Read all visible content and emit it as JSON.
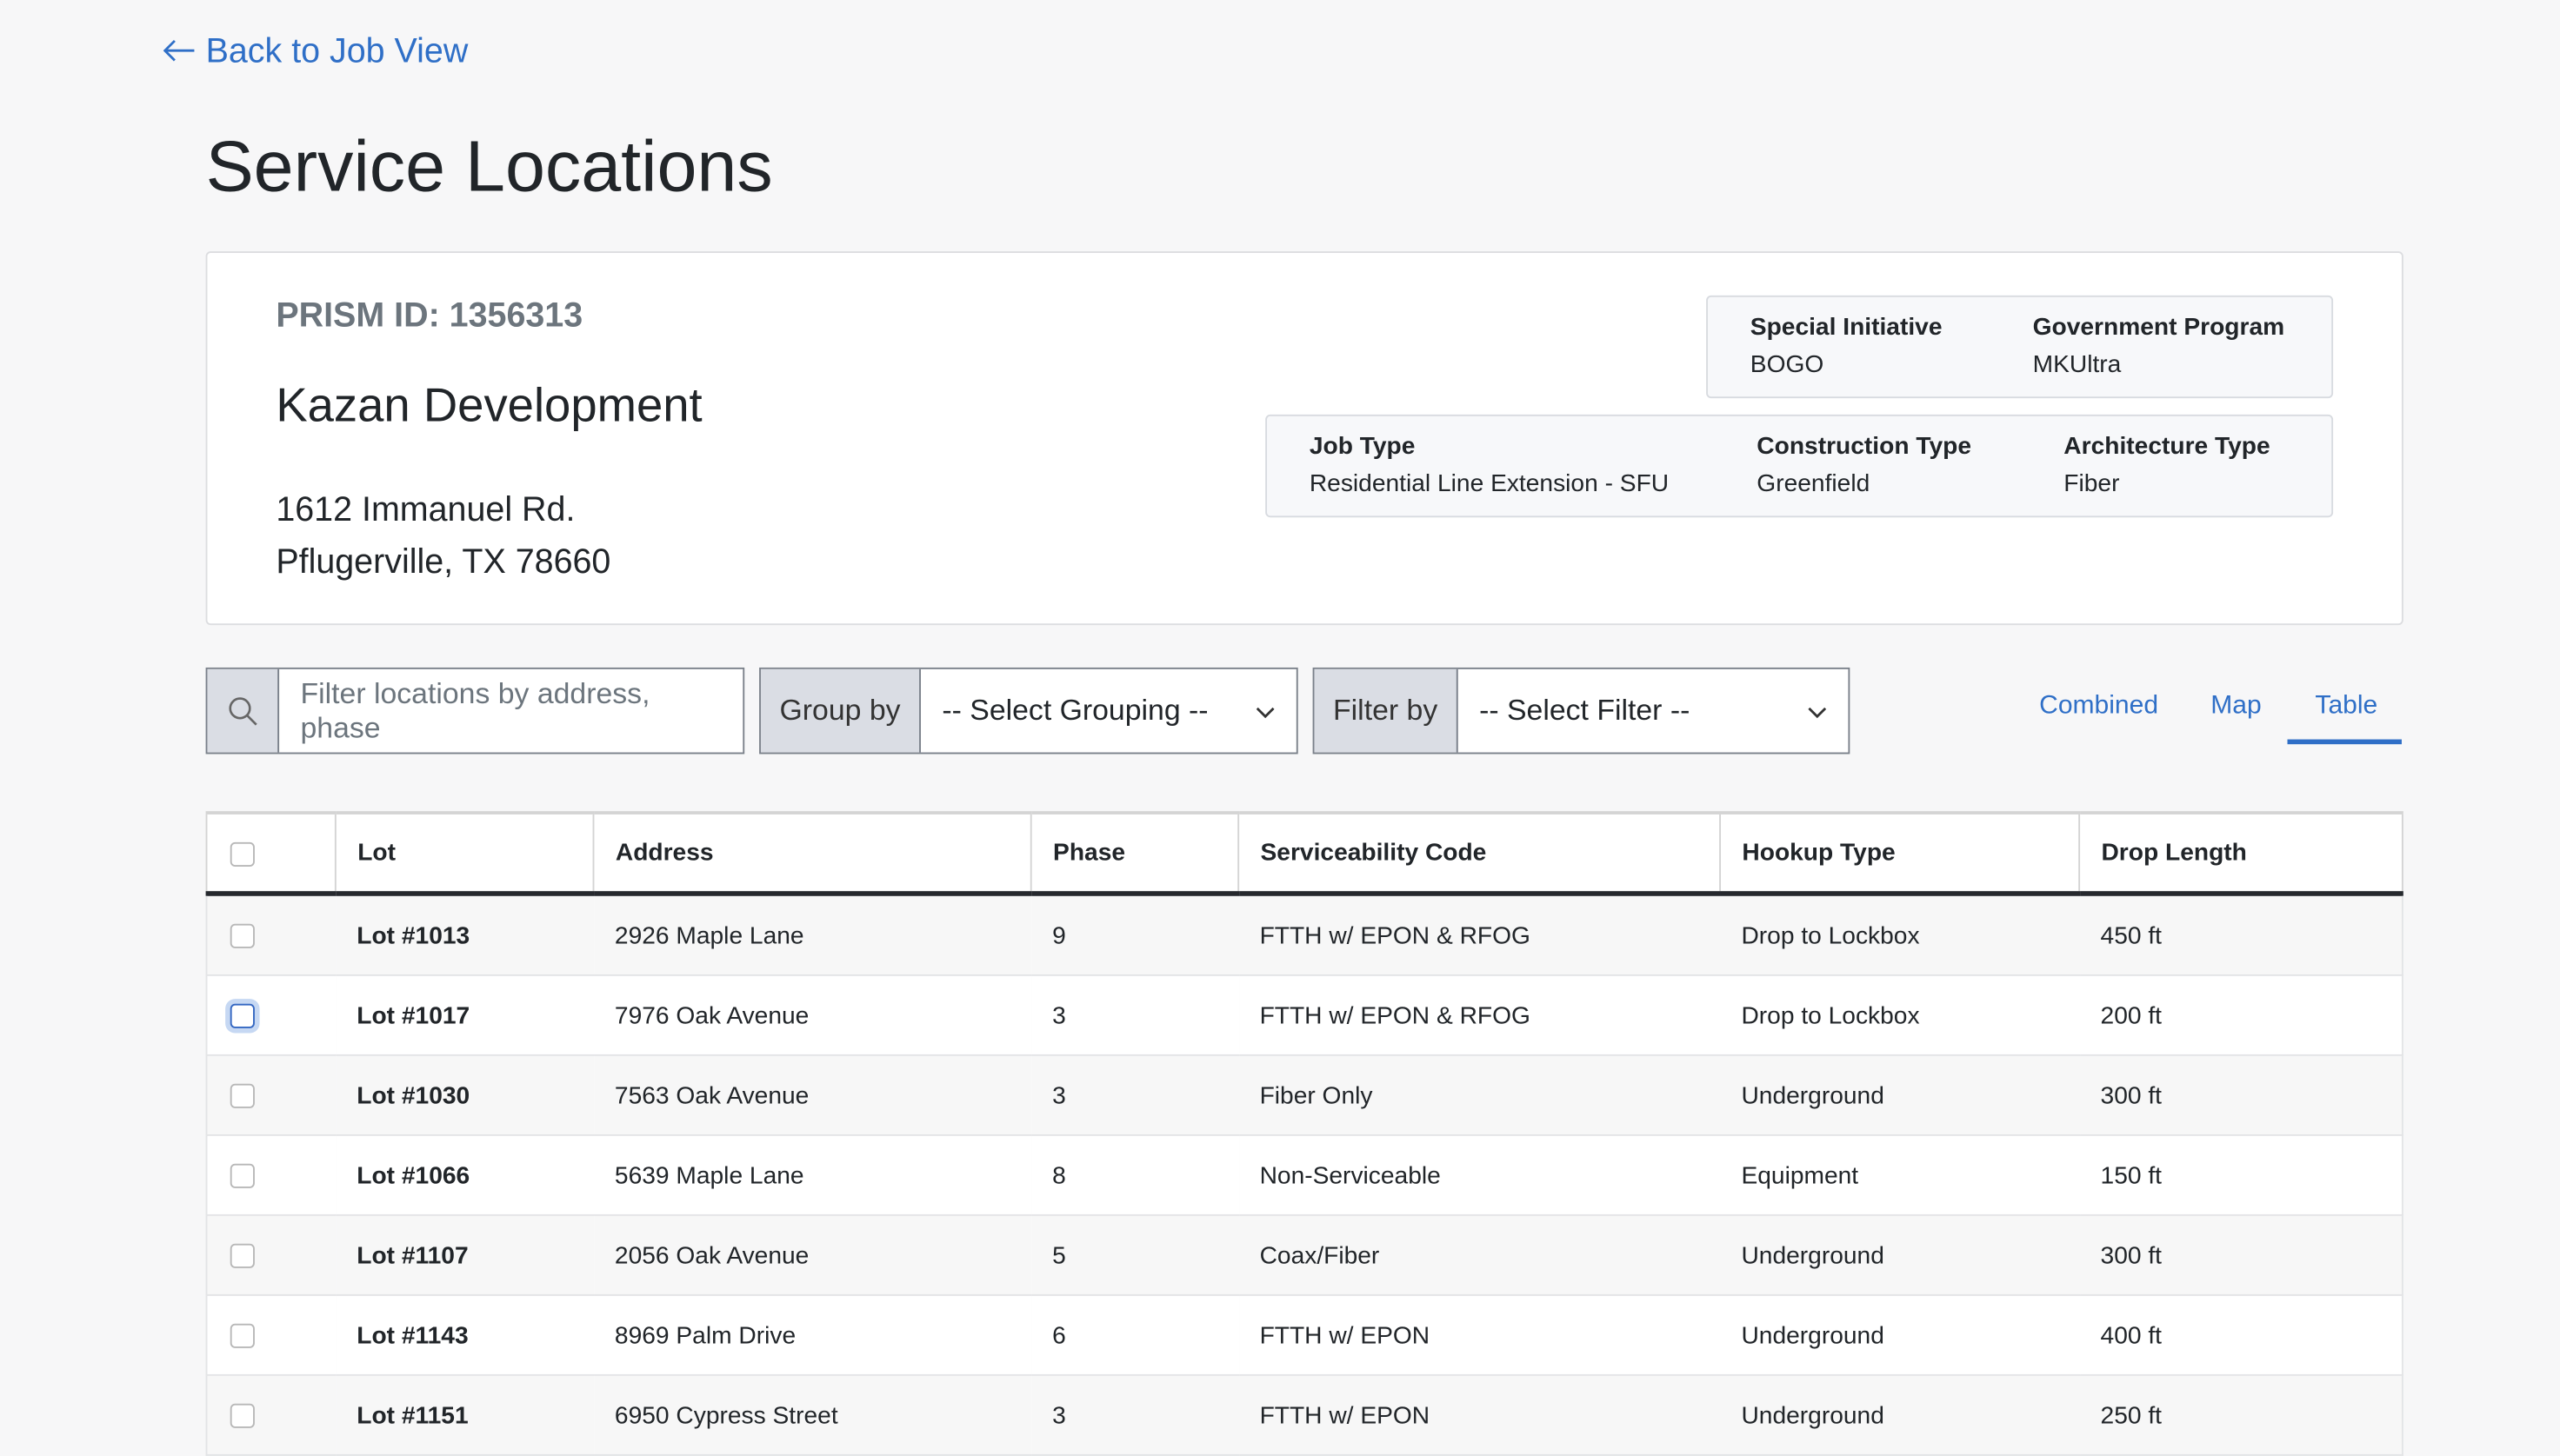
{
  "back_link": "Back to Job View",
  "page_title": "Service Locations",
  "job": {
    "prism_id": "PRISM ID: 1356313",
    "name": "Kazan Development",
    "address_line1": "1612 Immanuel Rd.",
    "address_line2": "Pflugerville, TX 78660"
  },
  "program_box": [
    {
      "label": "Special Initiative",
      "value": "BOGO"
    },
    {
      "label": "Government Program",
      "value": "MKUltra"
    }
  ],
  "type_box": [
    {
      "label": "Job Type",
      "value": "Residential Line Extension - SFU"
    },
    {
      "label": "Construction Type",
      "value": "Greenfield"
    },
    {
      "label": "Architecture Type",
      "value": "Fiber"
    }
  ],
  "controls": {
    "search_placeholder": "Filter locations by address, phase",
    "group_label": "Group by",
    "group_value": "-- Select Grouping --",
    "filter_label": "Filter by",
    "filter_value": "-- Select Filter --"
  },
  "view_tabs": [
    "Combined",
    "Map",
    "Table"
  ],
  "active_tab": "Table",
  "table": {
    "headers": [
      "Lot",
      "Address",
      "Phase",
      "Serviceability Code",
      "Hookup Type",
      "Drop Length"
    ],
    "rows": [
      [
        "Lot #1013",
        "2926 Maple Lane",
        "9",
        "FTTH w/ EPON & RFOG",
        "Drop to Lockbox",
        "450 ft"
      ],
      [
        "Lot #1017",
        "7976 Oak Avenue",
        "3",
        "FTTH w/ EPON & RFOG",
        "Drop to Lockbox",
        "200 ft"
      ],
      [
        "Lot #1030",
        "7563 Oak Avenue",
        "3",
        "Fiber Only",
        "Underground",
        "300 ft"
      ],
      [
        "Lot #1066",
        "5639 Maple Lane",
        "8",
        "Non-Serviceable",
        "Equipment",
        "150 ft"
      ],
      [
        "Lot #1107",
        "2056 Oak Avenue",
        "5",
        "Coax/Fiber",
        "Underground",
        "300 ft"
      ],
      [
        "Lot #1143",
        "8969 Palm Drive",
        "6",
        "FTTH w/ EPON",
        "Underground",
        "400 ft"
      ],
      [
        "Lot #1151",
        "6950 Cypress Street",
        "3",
        "FTTH w/ EPON",
        "Underground",
        "250 ft"
      ]
    ]
  }
}
